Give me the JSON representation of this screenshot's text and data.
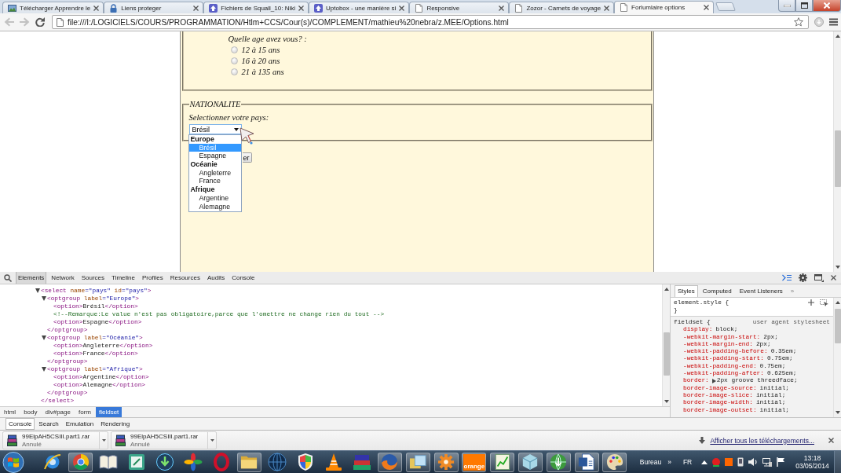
{
  "browser": {
    "tabs": [
      {
        "title": "Télécharger Apprendre le",
        "selected": false
      },
      {
        "title": "Liens proteger",
        "selected": false
      },
      {
        "title": "Fichiers de Squall_10: Niki",
        "selected": false
      },
      {
        "title": "Uptobox - une manière si",
        "selected": false
      },
      {
        "title": "Responsive",
        "selected": false
      },
      {
        "title": "Zozor - Carnets de voyage",
        "selected": false
      },
      {
        "title": "Forlumlaire options",
        "selected": true
      }
    ],
    "back": {
      "disabled": true
    },
    "forward": {
      "disabled": true
    },
    "address": "file:///I:/LOGICIELS/COURS/PROGRAMMATION/Htlm+CCS/Cour(s)/COMPLEMENT/mathieu%20nebra/z.MEE/Options.html"
  },
  "page": {
    "age_question": "Quelle age avez vous? :",
    "age_options": [
      {
        "label": "12 à 15 ans",
        "selected": false
      },
      {
        "label": "16 à 20 ans",
        "selected": false
      },
      {
        "label": "21 à 135 ans",
        "selected": false
      }
    ],
    "nationality": {
      "legend": "NATIONALITE",
      "prompt": "Selectionner votre pays:",
      "select": {
        "value": "Brésil",
        "expanded": true,
        "groups": [
          {
            "label": "Europe",
            "options": [
              {
                "label": "Brésil",
                "selected": true
              },
              {
                "label": "Espagne",
                "selected": false
              }
            ]
          },
          {
            "label": "Océanie",
            "options": [
              {
                "label": "Angleterre",
                "selected": false
              },
              {
                "label": "France",
                "selected": false
              }
            ]
          },
          {
            "label": "Afrique",
            "options": [
              {
                "label": "Argentine",
                "selected": false
              },
              {
                "label": "Alemagne",
                "selected": false
              }
            ]
          }
        ]
      }
    },
    "submit_button": "er"
  },
  "devtools": {
    "tabs": [
      {
        "label": "Elements",
        "selected": true
      },
      {
        "label": "Network",
        "selected": false
      },
      {
        "label": "Sources",
        "selected": false
      },
      {
        "label": "Timeline",
        "selected": false
      },
      {
        "label": "Profiles",
        "selected": false
      },
      {
        "label": "Resources",
        "selected": false
      },
      {
        "label": "Audits",
        "selected": false
      },
      {
        "label": "Console",
        "selected": false
      }
    ],
    "dom_tree": [
      {
        "tokens": [
          {
            "kind": "tag",
            "text": "<select"
          },
          {
            "kind": "attr",
            "text": " name"
          },
          {
            "kind": "value",
            "text": "=\"pays\""
          },
          {
            "kind": "attr",
            "text": " id"
          },
          {
            "kind": "value",
            "text": "=\"pays\""
          },
          {
            "kind": "tag",
            "text": ">"
          }
        ],
        "expanded": true,
        "children": [
          {
            "tokens": [
              {
                "kind": "tag",
                "text": "<optgroup"
              },
              {
                "kind": "attr",
                "text": " label"
              },
              {
                "kind": "value",
                "text": "=\"Europe\""
              },
              {
                "kind": "tag",
                "text": ">"
              }
            ],
            "expanded": true,
            "children": [
              {
                "tokens": [
                  {
                    "kind": "tag",
                    "text": "<option>"
                  },
                  {
                    "kind": "text",
                    "text": "Brésil"
                  },
                  {
                    "kind": "tag",
                    "text": "</option>"
                  }
                ]
              },
              {
                "tokens": [
                  {
                    "kind": "comment",
                    "text": "<!--Remarque:Le value n'est pas obligatoire,parce que l'omettre ne change rien du tout -->"
                  }
                ]
              },
              {
                "tokens": [
                  {
                    "kind": "tag",
                    "text": "<option>"
                  },
                  {
                    "kind": "text",
                    "text": "Espagne"
                  },
                  {
                    "kind": "tag",
                    "text": "</option>"
                  }
                ]
              }
            ],
            "closing": [
              {
                "kind": "tag",
                "text": "</optgroup>"
              }
            ]
          },
          {
            "tokens": [
              {
                "kind": "tag",
                "text": "<optgroup"
              },
              {
                "kind": "attr",
                "text": " label"
              },
              {
                "kind": "value",
                "text": "=\"Océanie\""
              },
              {
                "kind": "tag",
                "text": ">"
              }
            ],
            "expanded": true,
            "children": [
              {
                "tokens": [
                  {
                    "kind": "tag",
                    "text": "<option>"
                  },
                  {
                    "kind": "text",
                    "text": "Angleterre"
                  },
                  {
                    "kind": "tag",
                    "text": "</option>"
                  }
                ]
              },
              {
                "tokens": [
                  {
                    "kind": "tag",
                    "text": "<option>"
                  },
                  {
                    "kind": "text",
                    "text": "France"
                  },
                  {
                    "kind": "tag",
                    "text": "</option>"
                  }
                ]
              }
            ],
            "closing": [
              {
                "kind": "tag",
                "text": "</optgroup>"
              }
            ]
          },
          {
            "tokens": [
              {
                "kind": "tag",
                "text": "<optgroup"
              },
              {
                "kind": "attr",
                "text": " label"
              },
              {
                "kind": "value",
                "text": "=\"Afrique\""
              },
              {
                "kind": "tag",
                "text": ">"
              }
            ],
            "expanded": true,
            "children": [
              {
                "tokens": [
                  {
                    "kind": "tag",
                    "text": "<option>"
                  },
                  {
                    "kind": "text",
                    "text": "Argentine"
                  },
                  {
                    "kind": "tag",
                    "text": "</option>"
                  }
                ]
              },
              {
                "tokens": [
                  {
                    "kind": "tag",
                    "text": "<option>"
                  },
                  {
                    "kind": "text",
                    "text": "Alemagne"
                  },
                  {
                    "kind": "tag",
                    "text": "</option>"
                  }
                ]
              }
            ],
            "closing": [
              {
                "kind": "tag",
                "text": "</optgroup>"
              }
            ]
          }
        ],
        "closing": [
          {
            "kind": "tag",
            "text": "</select>"
          }
        ]
      }
    ],
    "breadcrumbs": [
      {
        "label": "html",
        "selected": false
      },
      {
        "label": "body",
        "selected": false
      },
      {
        "label": "div#page",
        "selected": false
      },
      {
        "label": "form",
        "selected": false
      },
      {
        "label": "fieldset",
        "selected": true
      }
    ],
    "drawer_tabs": [
      {
        "label": "Console",
        "selected": true
      },
      {
        "label": "Search",
        "selected": false
      },
      {
        "label": "Emulation",
        "selected": false
      },
      {
        "label": "Rendering",
        "selected": false
      }
    ],
    "styles": {
      "tabs": [
        {
          "label": "Styles",
          "selected": true
        },
        {
          "label": "Computed",
          "selected": false
        },
        {
          "label": "Event Listeners",
          "selected": false
        }
      ],
      "more_tabs": "»",
      "element_style": {
        "opening": "element.style {",
        "closing": "}"
      },
      "rules": [
        {
          "selector": "fieldset {",
          "source": "user agent stylesheet",
          "properties": [
            {
              "kind": "longhand",
              "name": "display:",
              "value": "block;"
            },
            {
              "kind": "longhand",
              "name": "-webkit-margin-start:",
              "value": "2px;"
            },
            {
              "kind": "longhand",
              "name": "-webkit-margin-end:",
              "value": "2px;"
            },
            {
              "kind": "longhand",
              "name": "-webkit-padding-before:",
              "value": "0.35em;"
            },
            {
              "kind": "longhand",
              "name": "-webkit-padding-start:",
              "value": "0.75em;"
            },
            {
              "kind": "longhand",
              "name": "-webkit-padding-end:",
              "value": "0.75em;"
            },
            {
              "kind": "longhand",
              "name": "-webkit-padding-after:",
              "value": "0.625em;"
            },
            {
              "kind": "shorthand",
              "name": "border:",
              "value": "2px groove threedface;",
              "expanded": false
            },
            {
              "kind": "longhand",
              "name": "border-image-source:",
              "value": "initial;"
            },
            {
              "kind": "longhand",
              "name": "border-image-slice:",
              "value": "initial;"
            },
            {
              "kind": "longhand",
              "name": "border-image-width:",
              "value": "initial;"
            },
            {
              "kind": "longhand",
              "name": "border-image-outset:",
              "value": "initial;"
            }
          ]
        }
      ]
    }
  },
  "downloads": {
    "items": [
      {
        "file": "99ElpAH5CSIII.part1.rar",
        "status": "Annulé"
      },
      {
        "file": "99ElpAH5CSIII.part1.rar",
        "status": "Annulé"
      }
    ],
    "show_all": "Afficher tous les téléchargements..."
  },
  "taskbar": {
    "logo_tile_text": "orange",
    "toolbar_label": "Bureau",
    "toolbar_more": "»",
    "language": "FR",
    "time": "13:18",
    "date": "03/05/2014"
  }
}
